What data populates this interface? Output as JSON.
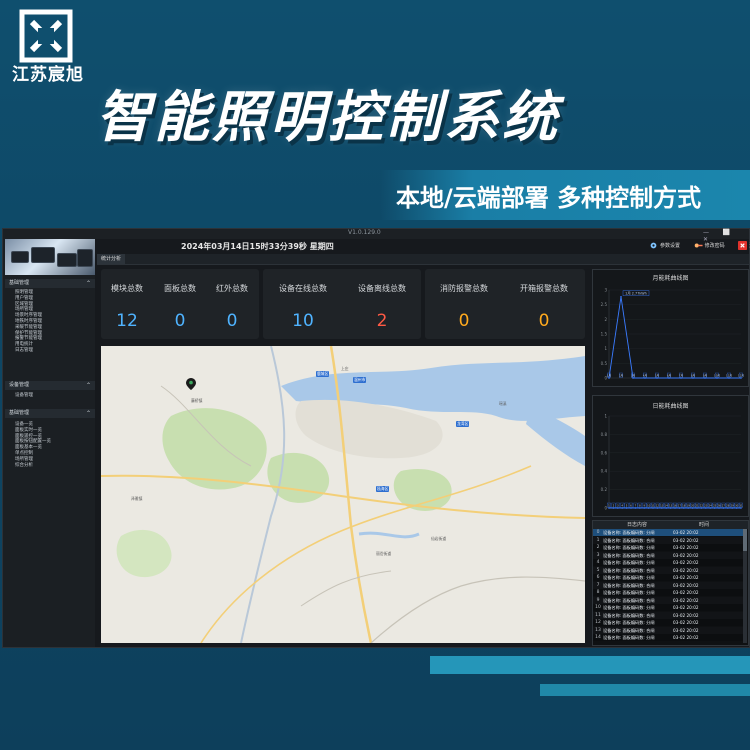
{
  "brand": {
    "name": "江苏宸旭",
    "logo_icon": "brand-logo-icon"
  },
  "headline": "智能照明控制系统",
  "sub_headline": "本地/云端部署 多种控制方式",
  "colors": {
    "accent_cyan": "#2aa6c9",
    "value_blue": "#4fb3ff",
    "value_red": "#ff5a45",
    "value_orange": "#ffaa1e",
    "line_blue": "#3a7bff",
    "window_bg": "#16191d"
  },
  "app": {
    "version": "V1.0.129.0",
    "datetime": "2024年03月14日15时33分39秒  星期四",
    "tab": "统计分析",
    "actions": [
      {
        "label": "参数设置",
        "icon": "gear-icon"
      },
      {
        "label": "修改密码",
        "icon": "key-icon"
      },
      {
        "label": "退出",
        "icon": "exit-icon"
      }
    ]
  },
  "sidebar": {
    "sections": [
      {
        "title": "基础管理",
        "items": [
          "照明管理",
          "用户管理",
          "区域管理",
          "场所管理",
          "场景时序管理",
          "地铁时序管理",
          "采暖节能管理",
          "保护节能管理",
          "报警节能管理",
          "用电统计",
          "日志管理"
        ]
      },
      {
        "title": "设备管理",
        "items": [
          "设备管理"
        ]
      },
      {
        "title": "基础管理",
        "items": [
          "设备一览",
          "面板实时一览",
          "面板遥控一览",
          "面板按钮配置一览",
          "面板基本一览",
          "单点控制",
          "场所管理",
          "综合分析"
        ]
      }
    ]
  },
  "stats": [
    {
      "label": "模块总数",
      "value": "12",
      "color": "#4fb3ff"
    },
    {
      "label": "面板总数",
      "value": "0",
      "color": "#4fb3ff"
    },
    {
      "label": "红外总数",
      "value": "0",
      "color": "#4fb3ff"
    },
    {
      "label": "设备在线总数",
      "value": "10",
      "color": "#4fb3ff"
    },
    {
      "label": "设备离线总数",
      "value": "2",
      "color": "#ff5a45"
    },
    {
      "label": "消防报警总数",
      "value": "0",
      "color": "#ffaa1e"
    },
    {
      "label": "开箱报警总数",
      "value": "0",
      "color": "#ffaa1e"
    }
  ],
  "map": {
    "labels": [
      "温州市",
      "鹿城区",
      "瓯海区",
      "龙湾区",
      "瑶溪",
      "仙岩街道",
      "丽岙街道",
      "上庄",
      "藤桥镇",
      "泽雅镇"
    ],
    "marker_icon": "map-pin-icon"
  },
  "chart_data": [
    {
      "type": "line",
      "title": "月能耗曲线图",
      "x": [
        "1月",
        "2月",
        "3月",
        "4月",
        "5月",
        "6月",
        "7月",
        "8月",
        "9月",
        "10月",
        "11月",
        "12月"
      ],
      "series": [
        {
          "values": [
            0.0,
            2.77,
            0.0,
            0.0,
            0.0,
            0.0,
            0.0,
            0.0,
            0.0,
            0.0,
            0.0,
            0.0
          ]
        }
      ],
      "ylim": [
        0,
        3
      ],
      "yticks": [
        "0",
        "0.5",
        "1",
        "1.5",
        "2",
        "2.5",
        "3"
      ],
      "annotation": "1月 2.77kWh"
    },
    {
      "type": "line",
      "title": "日能耗曲线图",
      "x": [
        "1",
        "2",
        "3",
        "4",
        "5",
        "6",
        "7",
        "8",
        "9",
        "10",
        "11",
        "12",
        "13",
        "14",
        "15",
        "16",
        "17",
        "18",
        "19",
        "20",
        "21",
        "22",
        "23",
        "24",
        "25",
        "26",
        "27",
        "28",
        "29",
        "30",
        "31"
      ],
      "series": [
        {
          "values": [
            0,
            0,
            0,
            0,
            0,
            0,
            0,
            0,
            0,
            0,
            0,
            0,
            0,
            0,
            0,
            0,
            0,
            0,
            0,
            0,
            0,
            0,
            0,
            0,
            0,
            0,
            0,
            0,
            0,
            0,
            0
          ]
        }
      ],
      "ylim": [
        0,
        1
      ],
      "yticks": [
        "0",
        "0.2",
        "0.4",
        "0.6",
        "0.8",
        "1"
      ]
    }
  ],
  "log": {
    "headers": [
      "日志内容",
      "时间"
    ],
    "rows": [
      {
        "idx": "0",
        "msg": "设备名称: 面板编码数: 分闸",
        "time": "03-02 20:02"
      },
      {
        "idx": "1",
        "msg": "设备名称: 面板编码数: 合闸",
        "time": "03-02 20:02"
      },
      {
        "idx": "2",
        "msg": "设备名称: 面板编码数: 分闸",
        "time": "03-02 20:02"
      },
      {
        "idx": "3",
        "msg": "设备名称: 面板编码数: 合闸",
        "time": "03-02 20:02"
      },
      {
        "idx": "4",
        "msg": "设备名称: 面板编码数: 分闸",
        "time": "03-02 20:02"
      },
      {
        "idx": "5",
        "msg": "设备名称: 面板编码数: 合闸",
        "time": "03-02 20:02"
      },
      {
        "idx": "6",
        "msg": "设备名称: 面板编码数: 分闸",
        "time": "03-02 20:02"
      },
      {
        "idx": "7",
        "msg": "设备名称: 面板编码数: 合闸",
        "time": "03-02 20:02"
      },
      {
        "idx": "8",
        "msg": "设备名称: 面板编码数: 分闸",
        "time": "03-02 20:02"
      },
      {
        "idx": "9",
        "msg": "设备名称: 面板编码数: 合闸",
        "time": "03-02 20:02"
      },
      {
        "idx": "10",
        "msg": "设备名称: 面板编码数: 分闸",
        "time": "03-02 20:02"
      },
      {
        "idx": "11",
        "msg": "设备名称: 面板编码数: 合闸",
        "time": "03-02 20:02"
      },
      {
        "idx": "12",
        "msg": "设备名称: 面板编码数: 分闸",
        "time": "03-02 20:02"
      },
      {
        "idx": "13",
        "msg": "设备名称: 面板编码数: 合闸",
        "time": "03-02 20:02"
      },
      {
        "idx": "14",
        "msg": "设备名称: 面板编码数: 分闸",
        "time": "03-02 20:02"
      }
    ]
  }
}
